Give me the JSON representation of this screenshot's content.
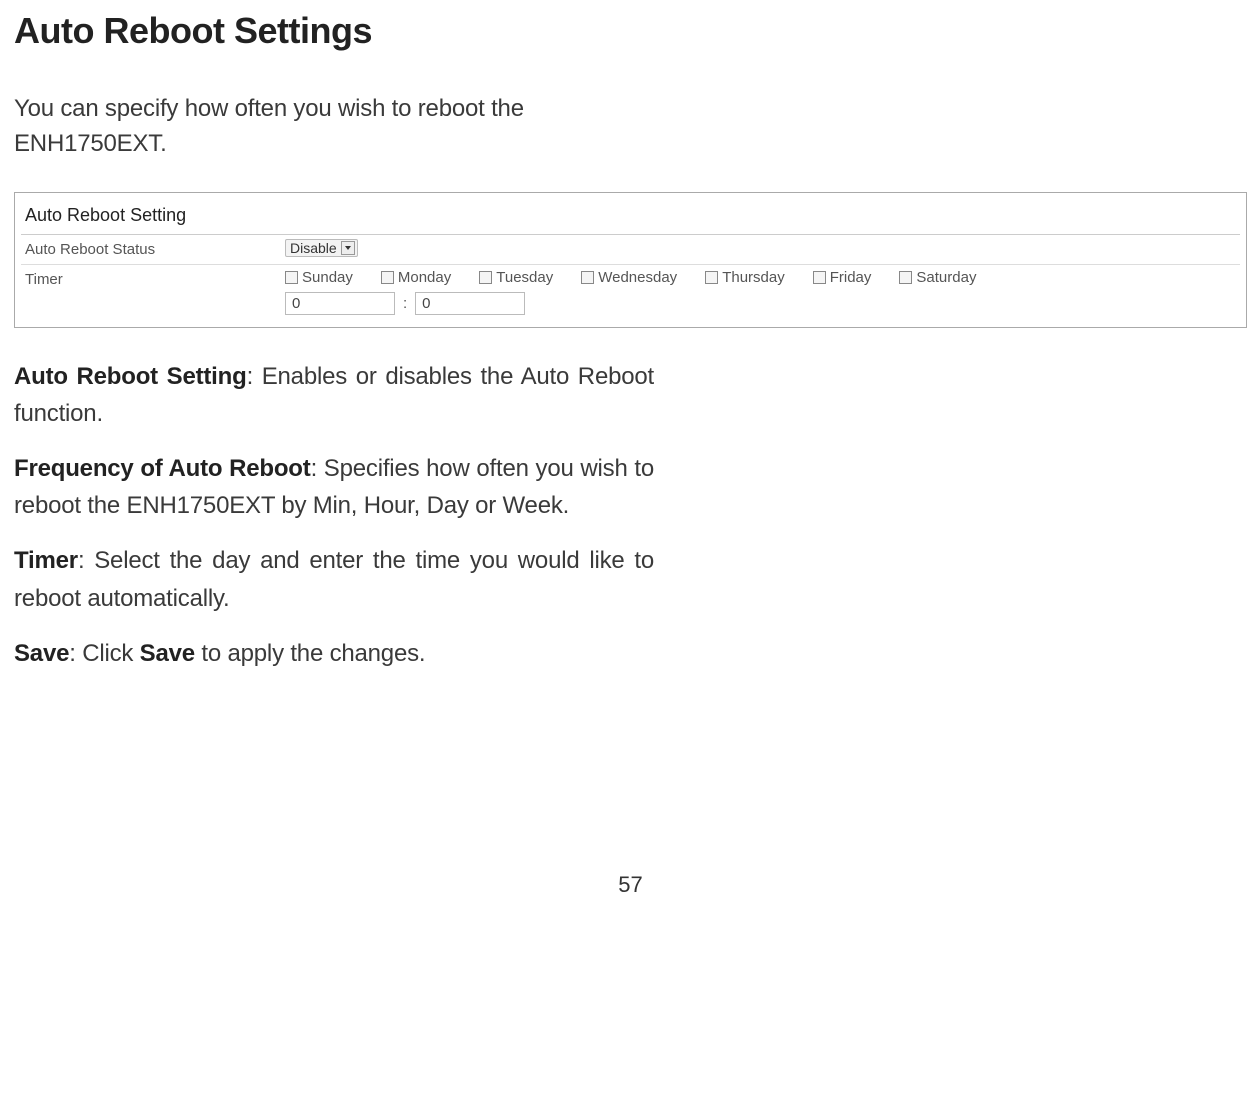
{
  "page": {
    "title": "Auto Reboot Settings",
    "intro_line1": "You can specify how often you wish to reboot the ",
    "intro_line2": "ENH1750EXT.",
    "page_number": "57"
  },
  "panel": {
    "header": "Auto Reboot Setting",
    "row_status_label": "Auto Reboot Status",
    "status_value": "Disable",
    "row_timer_label": "Timer",
    "days": {
      "sun": "Sunday",
      "mon": "Monday",
      "tue": "Tuesday",
      "wed": "Wednesday",
      "thu": "Thursday",
      "fri": "Friday",
      "sat": "Saturday"
    },
    "time_hour": "0",
    "time_sep": ":",
    "time_minute": "0"
  },
  "desc": {
    "d1_term": "Auto Reboot Setting",
    "d1_text": ": Enables or disables the Auto Reboot function.",
    "d2_term": "Frequency of Auto Reboot",
    "d2_text": ": Specifies how often you wish to reboot the ENH1750EXT by Min, Hour, Day or Week.",
    "d3_term": "Timer",
    "d3_text": ": Select the day and enter the time you would like to reboot automatically.",
    "d4_term": "Save",
    "d4_mid": ": Click ",
    "d4_bold": "Save",
    "d4_end": " to apply the changes."
  }
}
